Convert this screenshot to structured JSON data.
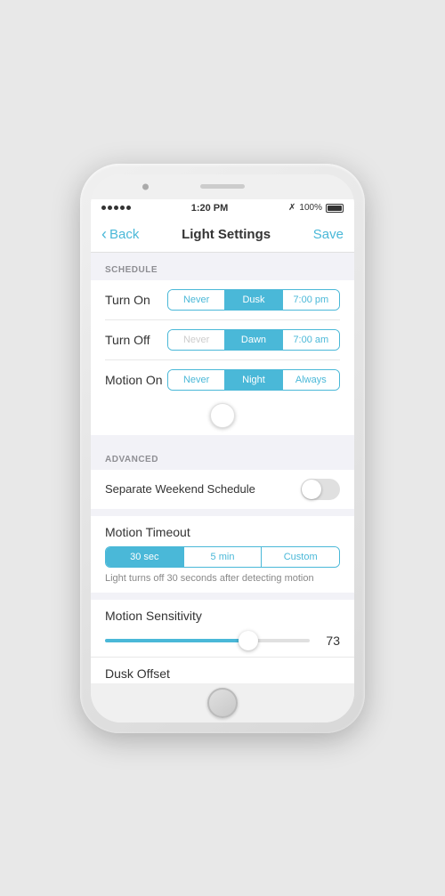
{
  "status_bar": {
    "time": "1:20 PM",
    "battery": "100%"
  },
  "nav": {
    "back_label": "Back",
    "title": "Light Settings",
    "save_label": "Save"
  },
  "schedule": {
    "section_label": "SCHEDULE",
    "turn_on": {
      "label": "Turn On",
      "options": [
        "Never",
        "Dusk",
        "7:00 pm"
      ],
      "active_index": 1
    },
    "turn_off": {
      "label": "Turn Off",
      "options": [
        "Never",
        "Dawn",
        "7:00 am"
      ],
      "active_index": 1
    },
    "motion_on": {
      "label": "Motion On",
      "options": [
        "Never",
        "Night",
        "Always"
      ],
      "active_index": 1
    }
  },
  "advanced": {
    "section_label": "ADVANCED",
    "weekend_schedule": {
      "label": "Separate Weekend Schedule",
      "enabled": false
    },
    "motion_timeout": {
      "label": "Motion Timeout",
      "options": [
        "30 sec",
        "5 min",
        "Custom"
      ],
      "active_index": 0,
      "description": "Light turns off 30 seconds after detecting motion"
    },
    "motion_sensitivity": {
      "label": "Motion Sensitivity",
      "value": 73,
      "fill_percent": 70
    },
    "dusk_offset": {
      "label": "Dusk Offset"
    }
  }
}
